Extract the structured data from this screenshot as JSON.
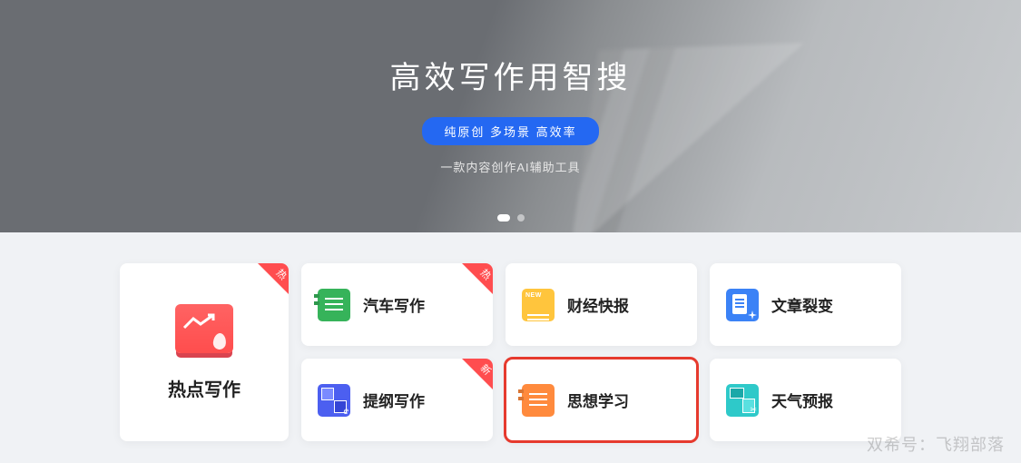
{
  "hero": {
    "title": "高效写作用智搜",
    "pill": "纯原创 多场景 高效率",
    "subtitle": "一款内容创作AI辅助工具"
  },
  "badges": {
    "hot": "热",
    "new": "新"
  },
  "featured_card": {
    "label": "热点写作",
    "badge": "hot"
  },
  "cards": [
    {
      "label": "汽车写作",
      "icon": "green-book",
      "badge": "hot"
    },
    {
      "label": "财经快报",
      "icon": "yellow-new",
      "badge": null
    },
    {
      "label": "文章裂变",
      "icon": "blue-doc",
      "badge": null
    },
    {
      "label": "提纲写作",
      "icon": "purple-grid",
      "badge": "new"
    },
    {
      "label": "思想学习",
      "icon": "orange-book",
      "badge": null,
      "highlighted": true
    },
    {
      "label": "天气预报",
      "icon": "teal-blocks",
      "badge": null
    }
  ],
  "watermark": "双希号：飞翔部落"
}
